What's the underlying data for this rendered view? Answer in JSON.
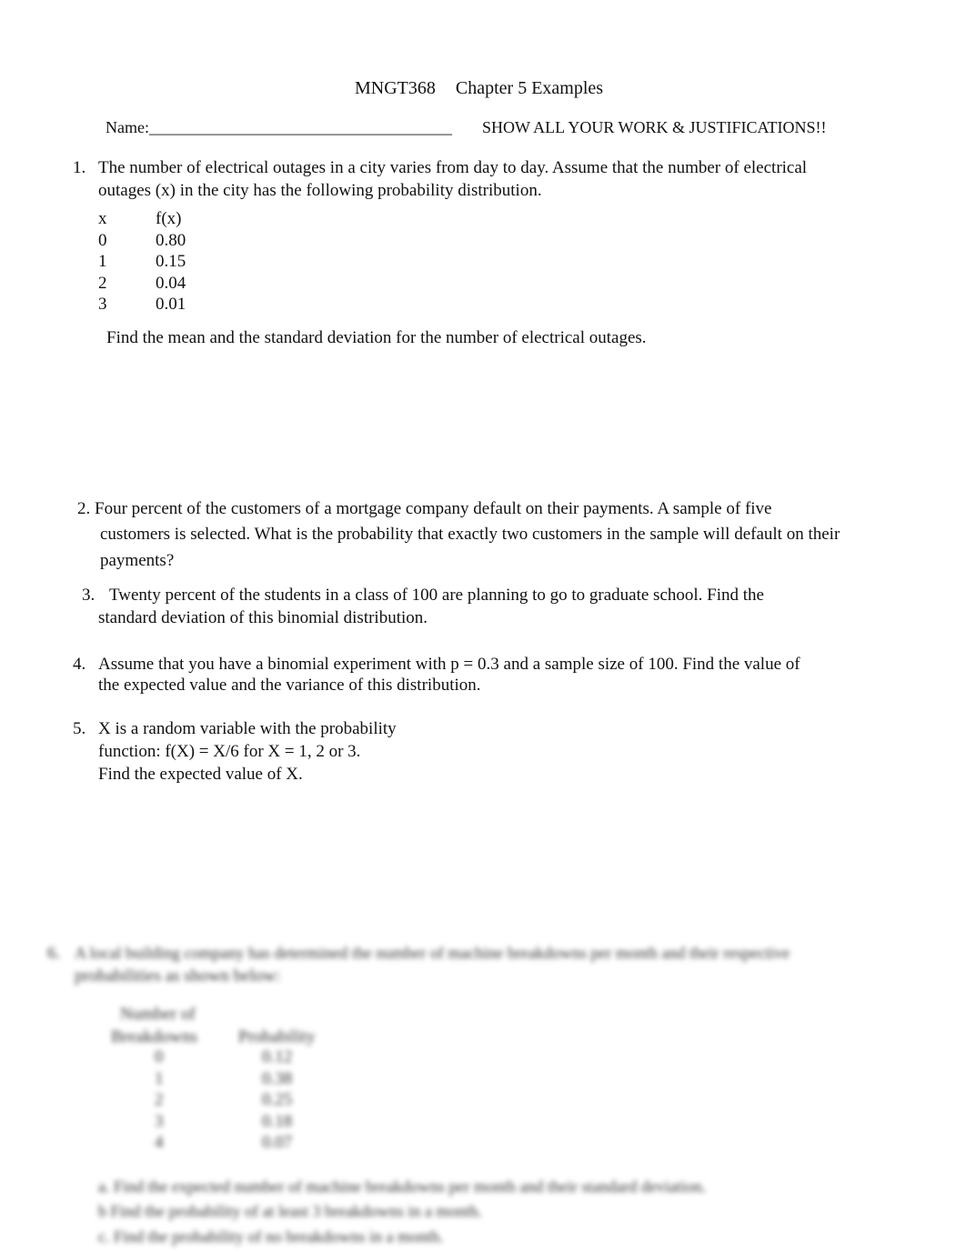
{
  "header": {
    "course": "MNGT368",
    "chapter": "Chapter 5 Examples",
    "name_label": "Name:_____________________________________",
    "instructions": "SHOW ALL YOUR WORK & JUSTIFICATIONS!!"
  },
  "q1": {
    "num": "1.",
    "line1": "The number of electrical outages in a city varies from day to day. Assume that the number of electrical",
    "line2": "outages (x)  in the city has the following probability distribution.",
    "table": {
      "headers": [
        "x",
        "f(x)"
      ],
      "rows": [
        [
          "0",
          "0.80"
        ],
        [
          "1",
          "0.15"
        ],
        [
          "2",
          "0.04"
        ],
        [
          "3",
          "0.01"
        ]
      ]
    },
    "task": "Find the mean and the standard deviation for the number of electrical outages."
  },
  "q2": {
    "line1": "2. Four percent of the customers of a mortgage company default on their payments. A sample of five",
    "line2": "customers is  selected. What is the probability that exactly two customers in the sample will default on their",
    "line3": "payments?"
  },
  "q3": {
    "num": "3.",
    "line1": "Twenty percent of the students in a class of 100 are planning to go to graduate school. Find the",
    "line2": "standard deviation of  this binomial distribution."
  },
  "q4": {
    "num": "4.",
    "line1": "Assume that you have a binomial experiment with p = 0.3 and a sample size of 100. Find the value of",
    "line2": "the expected value and the variance of this distribution."
  },
  "q5": {
    "num": "5.",
    "line1": "X is a random variable with the probability",
    "line2": "function:  f(X) = X/6     for X = 1, 2 or 3.",
    "line3": "Find the expected value of X."
  },
  "q6": {
    "num": "6.",
    "line1": "A local building company has determined the number of machine breakdowns per month and their respective",
    "line2": "probabilities as shown below:",
    "h1": "Number of",
    "h2": "Breakdowns",
    "h3": "Probability",
    "rows": [
      [
        "0",
        "0.12"
      ],
      [
        "1",
        "0.38"
      ],
      [
        "2",
        "0.25"
      ],
      [
        "3",
        "0.18"
      ],
      [
        "4",
        "0.07"
      ]
    ],
    "a": "a. Find the expected number of machine breakdowns per month and their standard deviation.",
    "b": "b Find the probability of at least 3 breakdowns in a month.",
    "c": "c. Find the probability of no breakdowns in a month."
  }
}
